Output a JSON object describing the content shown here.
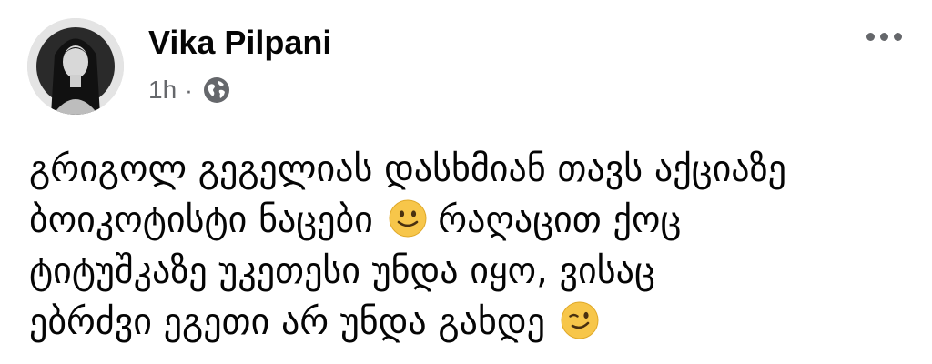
{
  "post": {
    "author": "Vika Pilpani",
    "time": "1h",
    "separator": "·",
    "privacy_icon": "globe-icon",
    "more_icon": "more-horizontal-icon",
    "avatar": "profile-photo",
    "text_lines": [
      "გრიგოლ გეგელიას დასხმიან თავს აქციაზე",
      "ბოიკოტისტი ნაცები",
      "რაღაცით ქოც",
      "ტიტუშკაზე უკეთესი უნდა იყო, ვისაც",
      "ებრძვი ეგეთი არ უნდა გახდე"
    ],
    "emojis": [
      "slightly-smiling-face",
      "winking-face"
    ]
  },
  "colors": {
    "text_primary": "#050505",
    "text_secondary": "#65676b",
    "background": "#ffffff",
    "emoji_yellow": "#f7c64a"
  }
}
